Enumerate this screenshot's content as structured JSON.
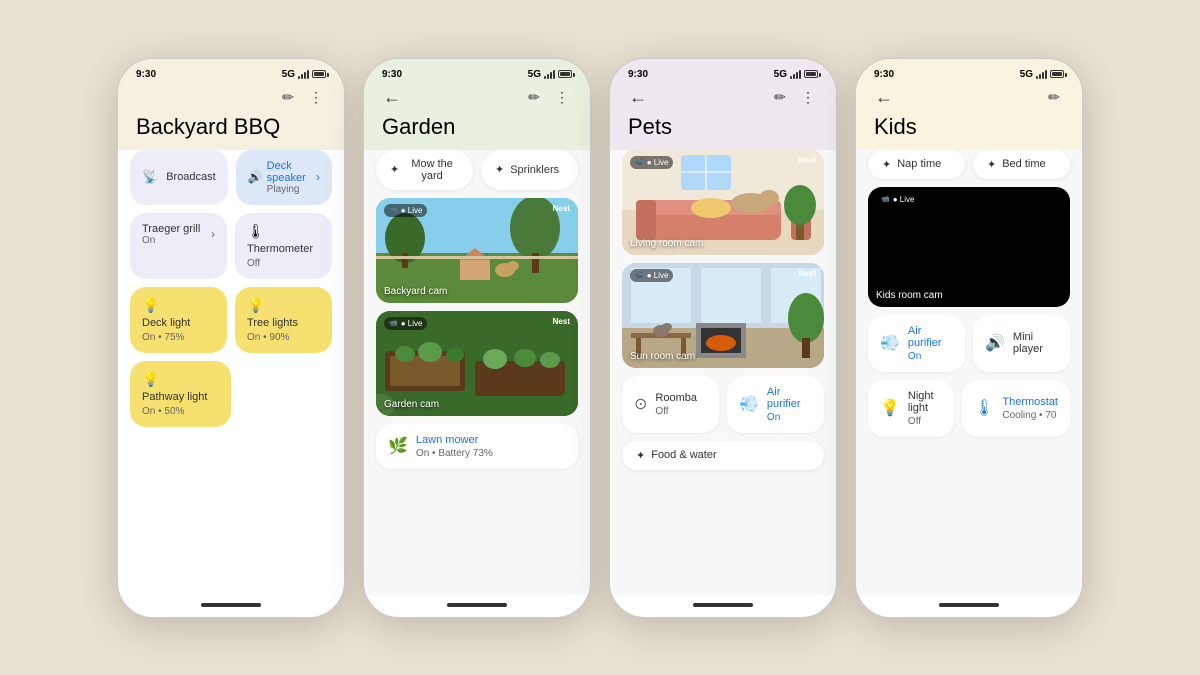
{
  "background": "#e8e0d0",
  "phones": [
    {
      "id": "bbq",
      "time": "9:30",
      "signal": "5G",
      "title": "Backyard BBQ",
      "theme": "yellow",
      "hasBack": false,
      "sections": [
        {
          "type": "card-row",
          "cards": [
            {
              "id": "broadcast",
              "label": "Broadcast",
              "sublabel": "",
              "color": "white",
              "icon": "broadcast"
            },
            {
              "id": "deck-speaker",
              "label": "Deck speaker",
              "sublabel": "Playing",
              "color": "blue",
              "icon": "speaker",
              "hasArrow": true
            }
          ]
        },
        {
          "type": "card-row",
          "cards": [
            {
              "id": "traeger-grill",
              "label": "Traeger grill",
              "sublabel": "On",
              "color": "white",
              "icon": "grill",
              "hasArrow": true
            },
            {
              "id": "thermometer",
              "label": "Thermometer",
              "sublabel": "Off",
              "color": "white",
              "icon": "thermometer"
            }
          ]
        },
        {
          "type": "card-row",
          "cards": [
            {
              "id": "deck-light",
              "label": "Deck light",
              "sublabel": "On • 75%",
              "color": "yellow",
              "icon": "light"
            },
            {
              "id": "tree-lights",
              "label": "Tree lights",
              "sublabel": "On • 90%",
              "color": "yellow",
              "icon": "light"
            }
          ]
        },
        {
          "type": "card-row",
          "cards": [
            {
              "id": "pathway-light",
              "label": "Pathway light",
              "sublabel": "On • 50%",
              "color": "yellow",
              "icon": "light"
            }
          ]
        }
      ]
    },
    {
      "id": "garden",
      "time": "9:30",
      "signal": "5G",
      "title": "Garden",
      "theme": "green",
      "hasBack": true,
      "sections": [
        {
          "type": "action-row",
          "buttons": [
            {
              "id": "mow-yard",
              "label": "Mow the yard",
              "icon": "sparkle"
            },
            {
              "id": "sprinklers",
              "label": "Sprinklers",
              "icon": "sparkle"
            }
          ]
        },
        {
          "type": "cam",
          "id": "backyard-cam",
          "label": "Backyard cam",
          "scene": "backyard"
        },
        {
          "type": "cam",
          "id": "garden-cam",
          "label": "Garden cam",
          "scene": "garden"
        },
        {
          "type": "device-row",
          "devices": [
            {
              "id": "lawn-mower",
              "label": "Lawn mower",
              "status": "On • Battery 73%",
              "icon": "mower",
              "color": "blue"
            }
          ]
        }
      ]
    },
    {
      "id": "pets",
      "time": "9:30",
      "signal": "5G",
      "title": "Pets",
      "theme": "purple",
      "hasBack": true,
      "sections": [
        {
          "type": "cam",
          "id": "living-cam",
          "label": "Living room cam",
          "scene": "living"
        },
        {
          "type": "cam",
          "id": "sun-cam",
          "label": "Sun room cam",
          "scene": "sunroom"
        },
        {
          "type": "device-row",
          "devices": [
            {
              "id": "roomba",
              "label": "Roomba",
              "status": "Off",
              "icon": "roomba"
            },
            {
              "id": "air-purifier",
              "label": "Air purifier",
              "status": "On",
              "icon": "purifier",
              "color": "blue",
              "statusColor": "blue"
            }
          ]
        },
        {
          "type": "action-row",
          "buttons": [
            {
              "id": "food-water",
              "label": "Food & water",
              "icon": "sparkle"
            }
          ]
        }
      ]
    },
    {
      "id": "kids",
      "time": "9:30",
      "signal": "5G",
      "title": "Kids",
      "theme": "yellow2",
      "hasBack": true,
      "sections": [
        {
          "type": "action-row",
          "buttons": [
            {
              "id": "nap-time",
              "label": "Nap time",
              "icon": "sparkle"
            },
            {
              "id": "bed-time",
              "label": "Bed time",
              "icon": "sparkle"
            }
          ]
        },
        {
          "type": "cam",
          "id": "kids-cam",
          "label": "Kids room cam",
          "scene": "kidsroom"
        },
        {
          "type": "device-row",
          "devices": [
            {
              "id": "air-purifier2",
              "label": "Air purifier",
              "status": "On",
              "icon": "purifier",
              "color": "blue",
              "statusColor": "blue"
            },
            {
              "id": "mini-player",
              "label": "Mini player",
              "status": "",
              "icon": "speaker"
            }
          ]
        },
        {
          "type": "device-row",
          "devices": [
            {
              "id": "night-light",
              "label": "Night light",
              "status": "Off",
              "icon": "lightbulb"
            },
            {
              "id": "thermostat",
              "label": "Thermostat",
              "status": "Cooling • 70",
              "icon": "thermostat",
              "color": "blue",
              "statusColor": "blue"
            }
          ]
        }
      ]
    }
  ],
  "icons": {
    "broadcast": "📡",
    "speaker": "🔊",
    "grill": "🔥",
    "thermometer": "🌡",
    "light": "💡",
    "sparkle": "✦",
    "mower": "🌿",
    "roomba": "⊙",
    "purifier": "💨",
    "lightbulb": "💡",
    "thermostat": "🌡",
    "back": "←",
    "edit": "✏",
    "menu": "⋮",
    "live": "● Live",
    "nest": "Nest",
    "camera": "📹"
  }
}
